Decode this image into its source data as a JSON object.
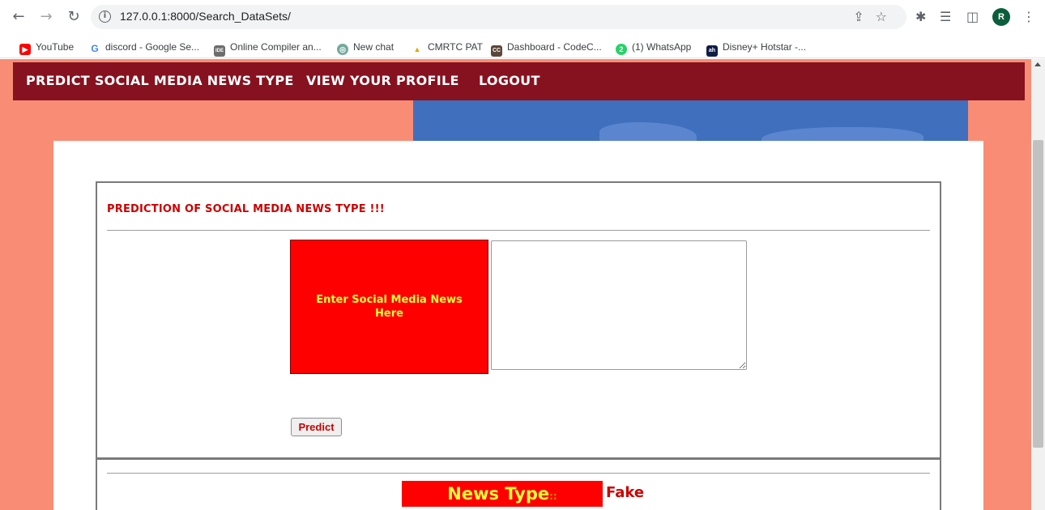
{
  "browser": {
    "url": "127.0.0.1:8000/Search_DataSets/",
    "profile_initial": "R",
    "back_icon": "arrow-left-icon",
    "forward_icon": "arrow-right-icon",
    "reload_icon": "reload-icon"
  },
  "bookmarks": [
    {
      "label": "YouTube",
      "icon": "youtube-icon",
      "color": "#ff0000",
      "glyph": "▶"
    },
    {
      "label": "discord - Google Se...",
      "icon": "google-icon",
      "color": "#4285f4",
      "glyph": "G"
    },
    {
      "label": "Online Compiler an...",
      "icon": "ide-icon",
      "color": "#6d6d6d",
      "glyph": "IDE"
    },
    {
      "label": "New chat",
      "icon": "chatgpt-icon",
      "color": "#74aa9c",
      "glyph": "◎"
    },
    {
      "label": "CMRTC PAT",
      "icon": "cmrtc-icon",
      "color": "#e0a800",
      "glyph": "▲"
    },
    {
      "label": "Dashboard - CodeC...",
      "icon": "codechef-icon",
      "color": "#5b4638",
      "glyph": "CC"
    },
    {
      "label": "(1) WhatsApp",
      "icon": "whatsapp-icon",
      "color": "#25d366",
      "glyph": "2"
    },
    {
      "label": "Disney+ Hotstar -...",
      "icon": "hotstar-icon",
      "color": "#0f1d46",
      "glyph": "ah"
    }
  ],
  "nav": {
    "predict": "PREDICT SOCIAL MEDIA NEWS TYPE",
    "profile": "VIEW YOUR PROFILE",
    "logout": "LOGOUT"
  },
  "form": {
    "heading": "PREDICTION OF SOCIAL MEDIA NEWS TYPE !!!",
    "input_label": "Enter Social Media News Here",
    "input_value": "",
    "predict_button": "Predict"
  },
  "result": {
    "label": "News Type",
    "separator": "::",
    "value": "Fake"
  },
  "colors": {
    "navbar": "#861220",
    "page_bg": "#f98c75",
    "accent_red": "#ff0000",
    "label_yellow": "#f5ff3c"
  }
}
